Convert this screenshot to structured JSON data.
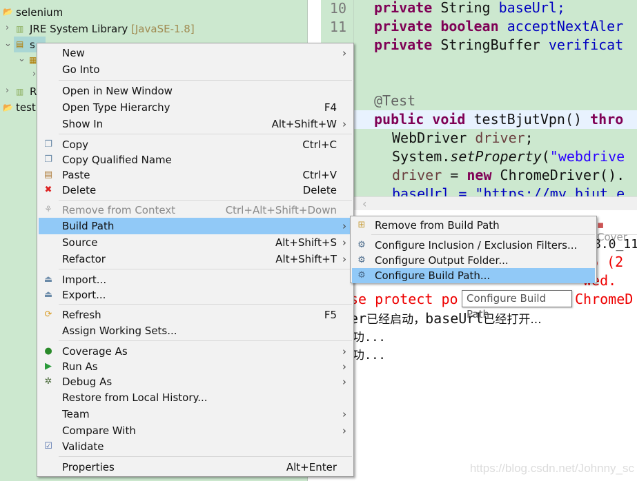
{
  "explorer": {
    "items": [
      {
        "label": "selenium",
        "icon": "project-folder-icon"
      },
      {
        "label": "JRE System Library",
        "decoration": "[JavaSE-1.8]",
        "icon": "library-icon"
      },
      {
        "label": "s",
        "icon": "source-folder-icon"
      },
      {
        "label": "R",
        "icon": "library-icon"
      },
      {
        "label": "test",
        "icon": "project-folder-icon"
      }
    ]
  },
  "editor": {
    "line_numbers": [
      "10",
      "11"
    ],
    "lines": [
      {
        "kw": "private",
        "type": "String",
        "field": "baseUrl;"
      },
      {
        "kw": "private",
        "kw2": "boolean",
        "field": "acceptNextAler"
      },
      {
        "kw": "private",
        "type": "StringBuffer",
        "field": "verificat"
      }
    ],
    "annotation": "@Test",
    "method_kw1": "public",
    "method_kw2": "void",
    "method_rest": "testBjutVpn()",
    "method_throws": "thro",
    "l_webdriver": "WebDriver",
    "l_driver": "driver",
    "l_system": "System.",
    "l_setprop": "setProperty",
    "l_paren": "(",
    "l_webdrive_str": "\"webdrive",
    "l_driver2": "driver",
    "l_eq": " = ",
    "l_new": "new",
    "l_chrome": " ChromeDriver().",
    "l_baseurl": "baseUrl = \"https://my.bjut.e"
  },
  "console": {
    "tab_label": "Cover",
    "path_fragment": "8.0_111\\",
    "red_lines": [
      ".6 (2",
      "wed.",
      "se protect po",
      "ChromeD"
    ],
    "line1_a": "er",
    "line1_b": "已经启动，",
    "line1_c": "baseUrl",
    "line1_d": "已经打开...",
    "line2": "功...",
    "line3": "功..."
  },
  "context_menu": {
    "items": [
      {
        "label": "New",
        "submenu": true
      },
      {
        "label": "Go Into"
      },
      {
        "label": "Open in New Window"
      },
      {
        "label": "Open Type Hierarchy",
        "shortcut": "F4"
      },
      {
        "label": "Show In",
        "shortcut": "Alt+Shift+W",
        "submenu": true
      },
      {
        "label": "Copy",
        "shortcut": "Ctrl+C",
        "icon": "copy-icon"
      },
      {
        "label": "Copy Qualified Name",
        "icon": "copy-qualified-icon"
      },
      {
        "label": "Paste",
        "shortcut": "Ctrl+V",
        "icon": "paste-icon"
      },
      {
        "label": "Delete",
        "shortcut": "Delete",
        "icon": "delete-icon"
      },
      {
        "label": "Remove from Context",
        "shortcut": "Ctrl+Alt+Shift+Down",
        "disabled": true,
        "icon": "remove-context-icon"
      },
      {
        "label": "Build Path",
        "submenu": true,
        "highlighted": true
      },
      {
        "label": "Source",
        "shortcut": "Alt+Shift+S",
        "submenu": true
      },
      {
        "label": "Refactor",
        "shortcut": "Alt+Shift+T",
        "submenu": true
      },
      {
        "label": "Import...",
        "icon": "import-icon"
      },
      {
        "label": "Export...",
        "icon": "export-icon"
      },
      {
        "label": "Refresh",
        "shortcut": "F5",
        "icon": "refresh-icon"
      },
      {
        "label": "Assign Working Sets..."
      },
      {
        "label": "Coverage As",
        "submenu": true,
        "icon": "coverage-icon"
      },
      {
        "label": "Run As",
        "submenu": true,
        "icon": "run-icon"
      },
      {
        "label": "Debug As",
        "submenu": true,
        "icon": "debug-icon"
      },
      {
        "label": "Restore from Local History..."
      },
      {
        "label": "Team",
        "submenu": true
      },
      {
        "label": "Compare With",
        "submenu": true
      },
      {
        "label": "Validate",
        "icon": "checkmark-icon"
      },
      {
        "label": "Properties",
        "shortcut": "Alt+Enter"
      }
    ]
  },
  "build_path_submenu": {
    "items": [
      {
        "label": "Remove from Build Path"
      },
      {
        "label": "Configure Inclusion / Exclusion Filters..."
      },
      {
        "label": "Configure Output Folder..."
      },
      {
        "label": "Configure Build Path...",
        "highlighted": true
      }
    ]
  },
  "tooltip": {
    "text": "Configure Build Path"
  },
  "watermark": "https://blog.csdn.net/Johnny_sc",
  "colors": {
    "editor_bg": "#cce8cf",
    "highlight": "#91c9f7",
    "keyword": "#7f0055",
    "error": "#ee0000"
  }
}
